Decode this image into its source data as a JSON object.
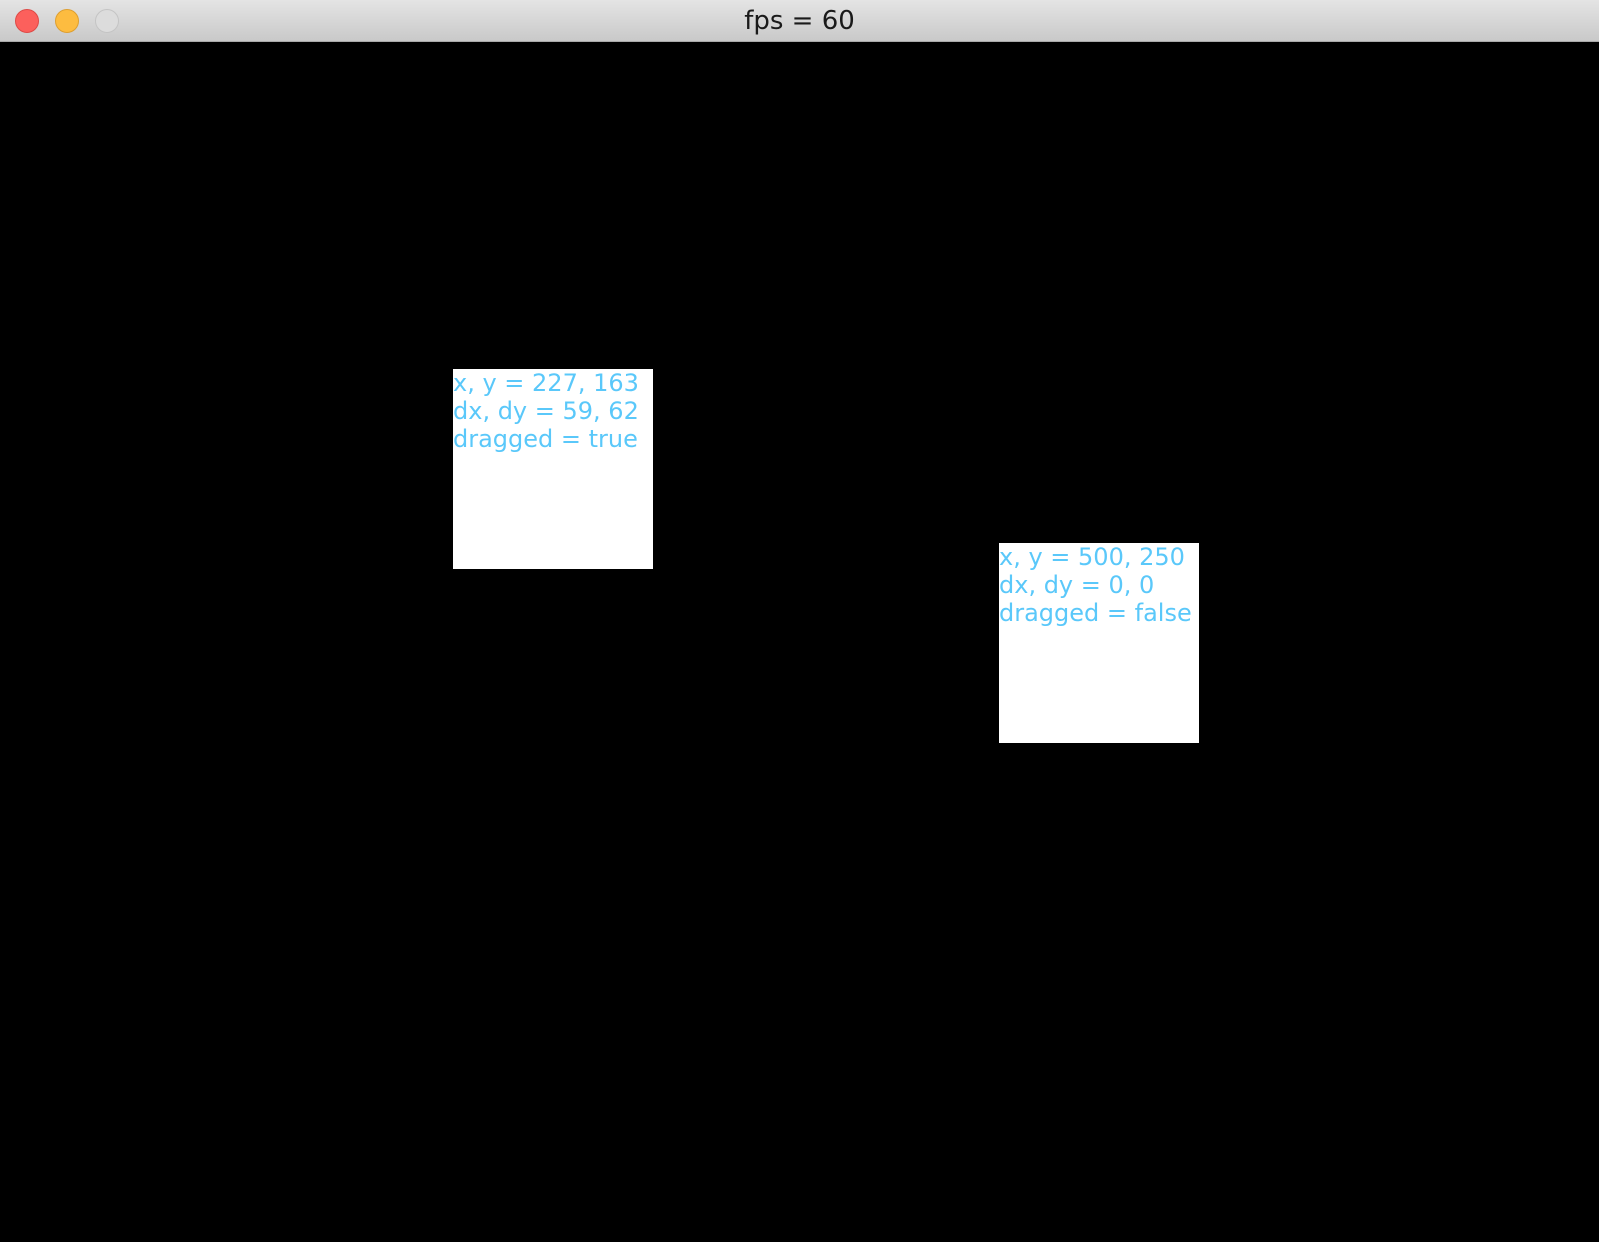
{
  "window": {
    "title": "fps = 60"
  },
  "colors": {
    "background": "#000000",
    "box": "#ffffff",
    "text": "#5ac8fa",
    "close": "#fc605c",
    "minimize": "#fdbc40",
    "zoom": "#dcdcdc"
  },
  "boxes": [
    {
      "position_line": "x, y = 227, 163",
      "delta_line": "dx, dy = 59, 62",
      "dragged_line": "dragged = true"
    },
    {
      "position_line": "x, y = 500, 250",
      "delta_line": "dx, dy = 0, 0",
      "dragged_line": "dragged = false"
    }
  ]
}
